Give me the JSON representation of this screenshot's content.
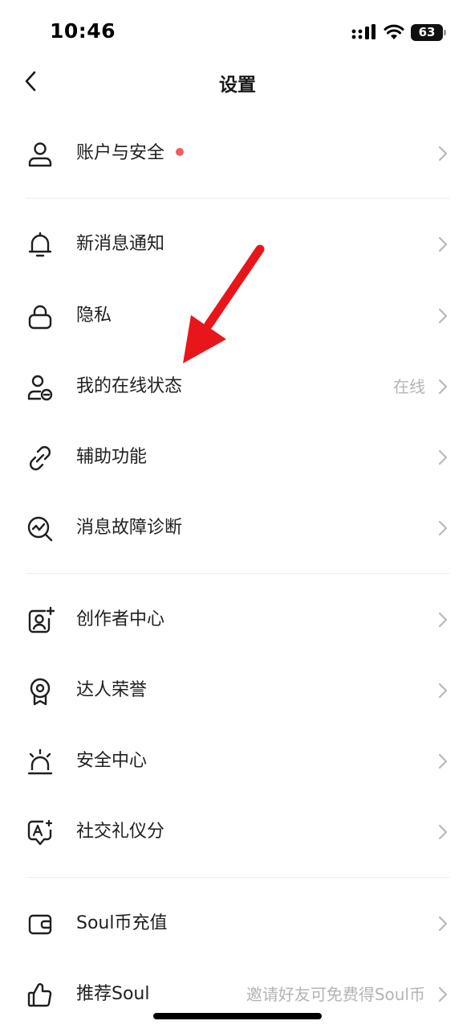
{
  "status_bar": {
    "time": "10:46",
    "battery": "63"
  },
  "nav": {
    "title": "设置"
  },
  "items": [
    {
      "label": "账户与安全",
      "value": ""
    },
    {
      "label": "新消息通知",
      "value": ""
    },
    {
      "label": "隐私",
      "value": ""
    },
    {
      "label": "我的在线状态",
      "value": "在线"
    },
    {
      "label": "辅助功能",
      "value": ""
    },
    {
      "label": "消息故障诊断",
      "value": ""
    },
    {
      "label": "创作者中心",
      "value": ""
    },
    {
      "label": "达人荣誉",
      "value": ""
    },
    {
      "label": "安全中心",
      "value": ""
    },
    {
      "label": "社交礼仪分",
      "value": ""
    },
    {
      "label": "Soul币充值",
      "value": ""
    },
    {
      "label": "推荐Soul",
      "value": "邀请好友可免费得Soul币"
    }
  ],
  "icons": [
    "user-icon",
    "bell-icon",
    "lock-icon",
    "user-status-icon",
    "link-icon",
    "diagnosis-icon",
    "creator-icon",
    "badge-icon",
    "alarm-icon",
    "etiquette-icon",
    "wallet-icon",
    "thumbs-up-icon"
  ],
  "colors": {
    "badge_dot": "#f05b5b",
    "annotation_arrow": "#e8161b"
  }
}
